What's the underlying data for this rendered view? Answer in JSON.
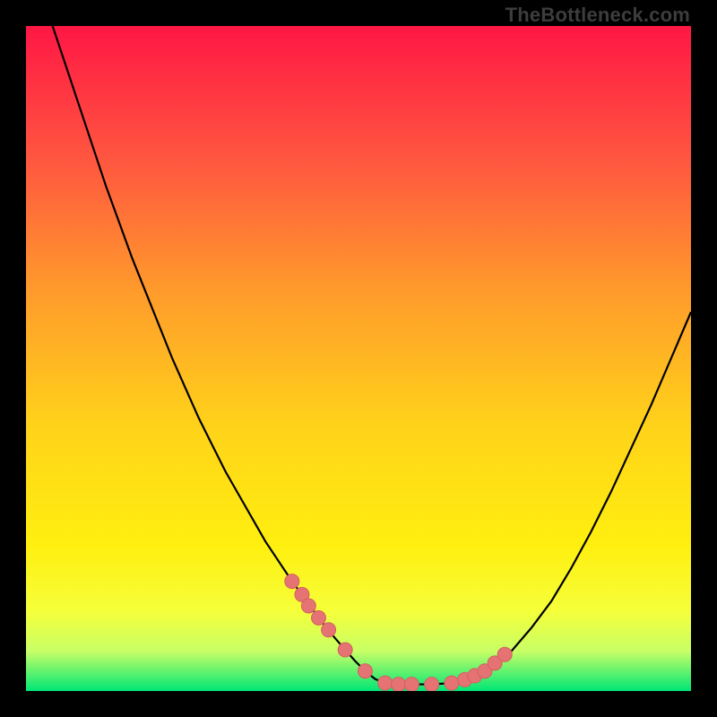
{
  "watermark": "TheBottleneck.com",
  "colors": {
    "frame": "#000000",
    "gradient_top": "#ff1744",
    "gradient_mid1": "#ff5640",
    "gradient_mid2": "#ff9b2b",
    "gradient_mid3": "#ffd21a",
    "gradient_mid4": "#ffef0f",
    "gradient_mid5": "#f5ff3a",
    "gradient_mid6": "#c8ff66",
    "gradient_bottom": "#00e676",
    "curve": "#000000",
    "marker_fill": "#e57373",
    "marker_stroke": "#d46060"
  },
  "chart_data": {
    "type": "line",
    "title": "",
    "xlabel": "",
    "ylabel": "",
    "xlim": [
      0,
      100
    ],
    "ylim": [
      0,
      100
    ],
    "curve": {
      "x": [
        4.0,
        6.0,
        8.0,
        10.0,
        12.0,
        14.0,
        16.0,
        18.0,
        20.0,
        22.0,
        24.0,
        26.0,
        28.0,
        30.0,
        32.0,
        34.0,
        36.0,
        38.0,
        40.0,
        42.0,
        44.0,
        46.0,
        48.0,
        49.5,
        51.0,
        52.5,
        54.0,
        56.0,
        58.0,
        61.0,
        64.0,
        67.0,
        70.0,
        73.0,
        76.0,
        79.0,
        82.0,
        85.0,
        88.0,
        91.0,
        94.0,
        97.0,
        100.0
      ],
      "y": [
        100.0,
        94.0,
        88.0,
        82.0,
        76.0,
        70.5,
        65.0,
        60.0,
        55.0,
        50.0,
        45.5,
        41.0,
        37.0,
        33.0,
        29.5,
        26.0,
        22.5,
        19.5,
        16.5,
        13.8,
        11.0,
        8.5,
        6.2,
        4.5,
        3.0,
        1.8,
        1.2,
        1.0,
        1.0,
        1.0,
        1.2,
        2.0,
        3.5,
        6.0,
        9.5,
        13.5,
        18.5,
        24.0,
        30.0,
        36.5,
        43.0,
        50.0,
        57.0
      ]
    },
    "markers": {
      "x": [
        40.0,
        41.5,
        42.5,
        44.0,
        45.5,
        48.0,
        51.0,
        54.0,
        56.0,
        58.0,
        61.0,
        64.0,
        66.0,
        67.5,
        69.0,
        70.5,
        72.0
      ],
      "y": [
        16.5,
        14.5,
        12.8,
        11.0,
        9.2,
        6.2,
        3.0,
        1.2,
        1.0,
        1.0,
        1.0,
        1.2,
        1.7,
        2.3,
        3.0,
        4.2,
        5.5
      ]
    }
  }
}
